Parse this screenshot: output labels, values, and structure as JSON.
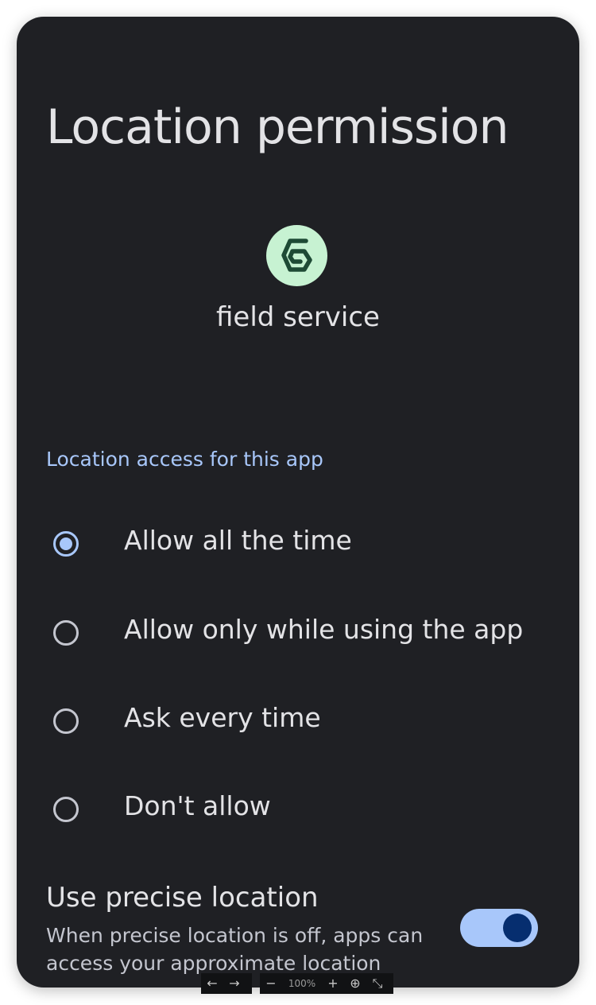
{
  "screen": {
    "title": "Location permission",
    "app_name": "field service",
    "section_header": "Location access for this app",
    "options": [
      {
        "label": "Allow all the time",
        "selected": true
      },
      {
        "label": "Allow only while using the app",
        "selected": false
      },
      {
        "label": "Ask every time",
        "selected": false
      },
      {
        "label": "Don't allow",
        "selected": false
      }
    ],
    "precise": {
      "title": "Use precise location",
      "description": "When precise location is off, apps can access your approximate location",
      "enabled": true
    }
  },
  "viewer": {
    "back_icon": "←",
    "forward_icon": "→",
    "zoom_out_icon": "−",
    "zoom_level": "100%",
    "zoom_in_icon": "+",
    "download_icon": "⊕",
    "collapse_icon": "⤡"
  },
  "colors": {
    "background": "#1f2024",
    "accent": "#a8c7fa",
    "app_icon_bg": "#c7f2d2",
    "app_icon_fg": "#1e4a35",
    "toggle_knob": "#062e6f"
  }
}
